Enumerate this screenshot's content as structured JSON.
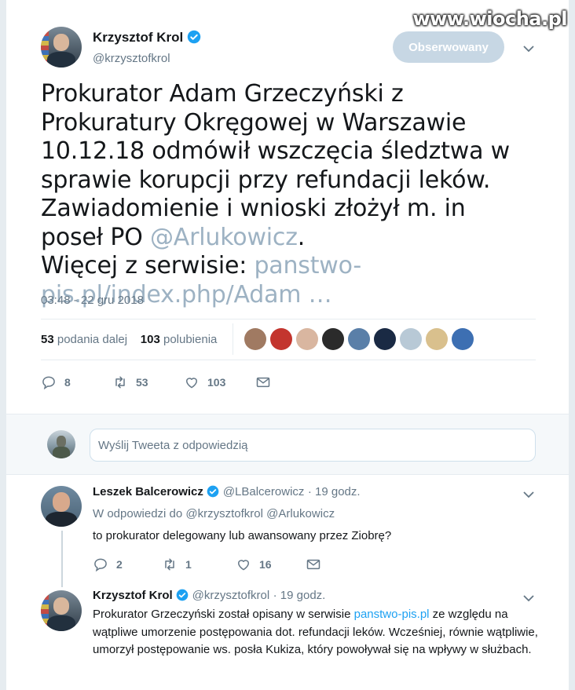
{
  "watermark": "www.wiocha.pl",
  "main_tweet": {
    "author_name": "Krzysztof Krol",
    "author_handle": "@krzysztofkrol",
    "follow_label": "Obserwowany",
    "text_part1": "Prokurator Adam Grzeczyński z Prokuratury Okręgowej w Warszawie 10.12.18 odmówił wszczęcia śledztwa w sprawie korupcji przy refundacji leków. Zawiadomienie i wnioski złożył m. in poseł PO ",
    "mention": "@Arlukowicz",
    "text_part2": ".",
    "text_part3": "Więcej z serwisie: ",
    "link": "panstwo-pis.pl/index.php/Adam …",
    "timestamp": "03:48 - 22 gru 2018",
    "retweets_count": "53",
    "retweets_label": "podania dalej",
    "likes_count": "103",
    "likes_label": "polubienia",
    "actions": {
      "replies": "8",
      "retweets": "53",
      "likes": "103"
    },
    "liker_colors": [
      "#a07a62",
      "#c3352e",
      "#d9b6a0",
      "#2b2b2b",
      "#5a7fa8",
      "#1a2a44",
      "#b8c9d6",
      "#d9c08d",
      "#3d6fb2"
    ]
  },
  "reply_box": {
    "placeholder": "Wyślij Tweeta z odpowiedzią"
  },
  "replies": [
    {
      "author_name": "Leszek Balcerowicz",
      "author_handle": "@LBalcerowicz",
      "time": "· 19 godz.",
      "reply_to_label": "W odpowiedzi do",
      "reply_to_1": "@krzysztofkrol",
      "reply_to_2": "@Arlukowicz",
      "text": "to prokurator delegowany lub awansowany przez Ziobrę?",
      "actions": {
        "replies": "2",
        "retweets": "1",
        "likes": "16"
      }
    },
    {
      "author_name": "Krzysztof Krol",
      "author_handle": "@krzysztofkrol",
      "time": "· 19 godz.",
      "text_part1": "Prokurator Grzeczyński został opisany w serwisie ",
      "link": "panstwo-pis.pl",
      "text_part2": " ze względu na wątpliwe umorzenie postępowania dot. refundacji leków. Wcześniej, równie wątpliwie, umorzył postępowanie ws. posła Kukiza, który powoływał się na wpływy w służbach."
    }
  ]
}
